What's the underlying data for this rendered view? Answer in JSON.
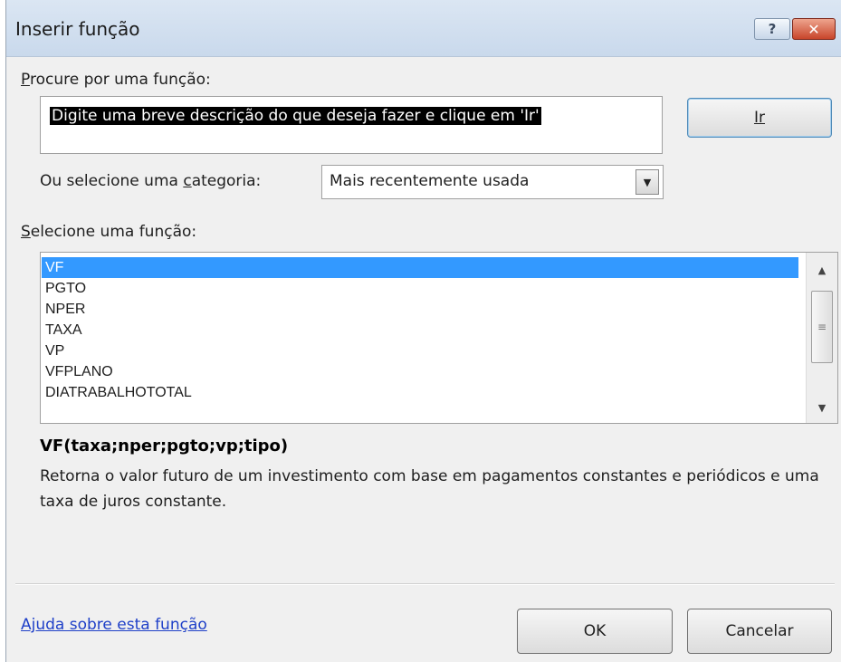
{
  "window": {
    "title": "Inserir função",
    "help_glyph": "?",
    "close_glyph": "✕"
  },
  "search": {
    "label": "Procure por uma função:",
    "label_accel": "P",
    "label_rest": "rocure por uma função:",
    "value": "Digite uma breve descrição do que deseja fazer e clique em 'Ir'",
    "go_button": "Ir"
  },
  "category": {
    "label_pre": "Ou selecione uma ",
    "label_accel": "c",
    "label_post": "ategoria:",
    "selected": "Mais recentemente usada",
    "arrow_glyph": "▼"
  },
  "function_list": {
    "label_accel": "S",
    "label_rest": "elecione uma função:",
    "items": [
      "VF",
      "PGTO",
      "NPER",
      "TAXA",
      "VP",
      "VFPLANO",
      "DIATRABALHOTOTAL"
    ],
    "selected_index": 0,
    "scroll_up_glyph": "▲",
    "scroll_down_glyph": "▼",
    "thumb_glyph": "≡"
  },
  "details": {
    "syntax": "VF(taxa;nper;pgto;vp;tipo)",
    "description": "Retorna o valor futuro de um investimento com base em pagamentos constantes e periódicos e uma taxa de juros constante."
  },
  "footer": {
    "help_link": "Ajuda sobre esta função",
    "ok_button": "OK",
    "cancel_button": "Cancelar"
  },
  "colors": {
    "selection": "#3399ff",
    "link": "#1f40c8",
    "close_button": "#c8452b",
    "dialog_background": "#f0f0f0"
  }
}
